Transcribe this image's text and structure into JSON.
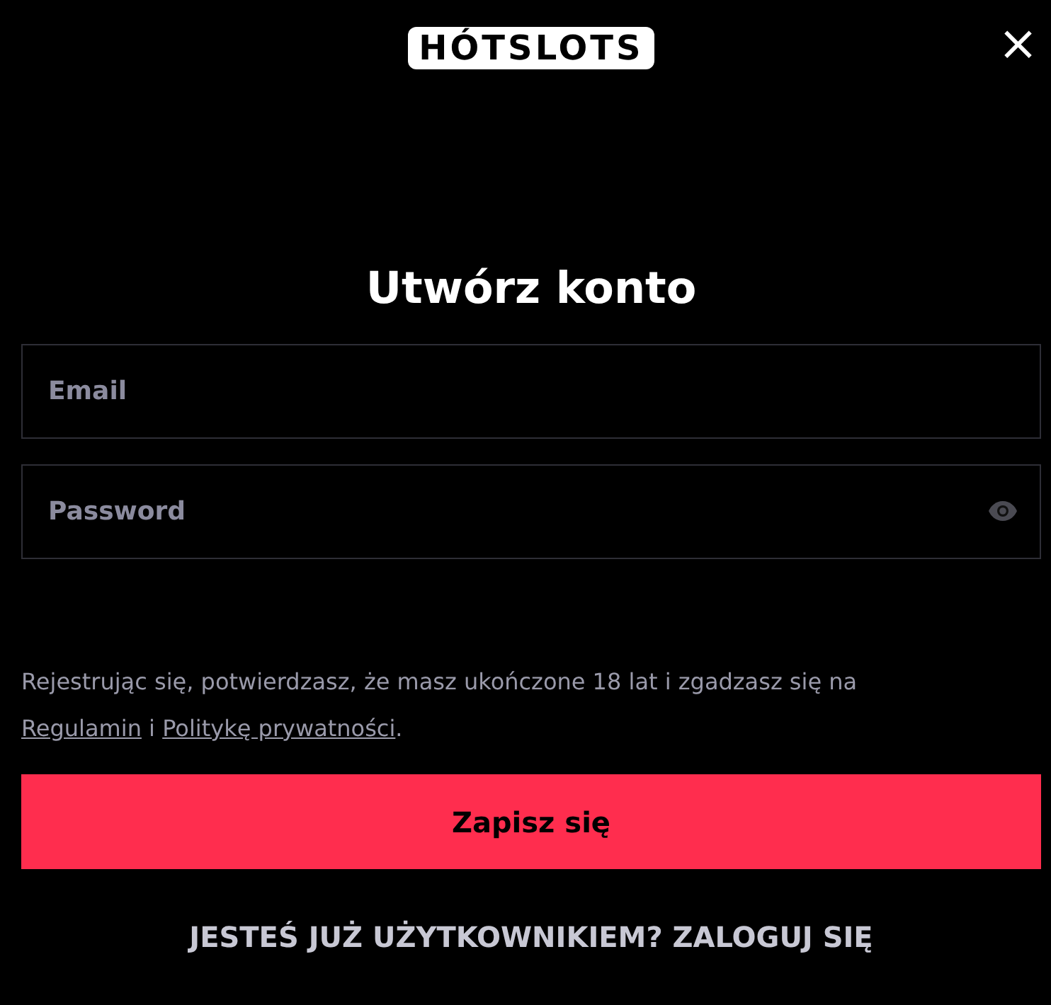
{
  "logo": "HÓTSLOTS",
  "close_button": "×",
  "title": "Utwórz konto",
  "fields": [
    {
      "placeholder": "Email",
      "kind": "text"
    },
    {
      "placeholder": "Password",
      "kind": "password"
    }
  ],
  "consent": {
    "before": "Rejestrując się, potwierdzasz, że masz ukończone 18 lat i zgadzasz się na",
    "link_1": "Regulamin",
    "middle": "i",
    "link_2": "Politykę prywatności",
    "after": "."
  },
  "submit_button": "Zapisz się",
  "login_link": "JESTEŚ JUŻ UŻYTKOWNIKIEM? ZALOGUJ SIĘ"
}
